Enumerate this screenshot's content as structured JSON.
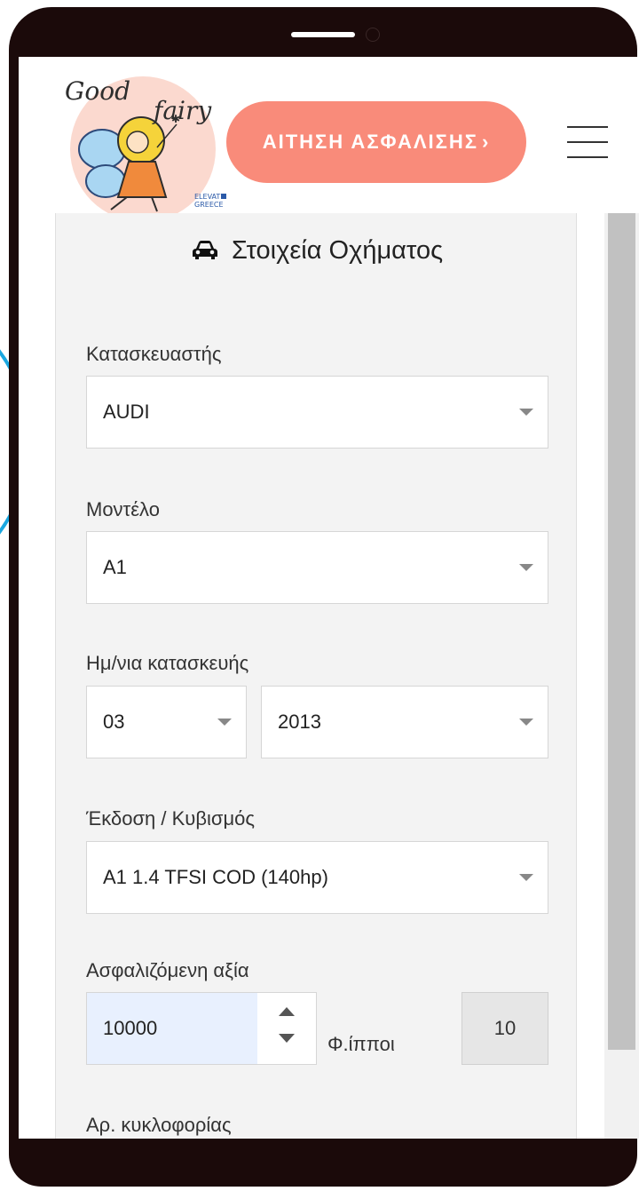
{
  "header": {
    "logo": {
      "line1": "Good",
      "line2": "fairy",
      "badge_line1": "ELEVATE",
      "badge_line2": "GREECE"
    },
    "cta_label": "ΑΙΤΗΣΗ ΑΣΦΑΛΙΣΗΣ",
    "cta_arrow": "›"
  },
  "section": {
    "title": "Στοιχεία Οχήματος",
    "icon": "car-icon"
  },
  "fields": {
    "manufacturer": {
      "label": "Κατασκευαστής",
      "value": "AUDI"
    },
    "model": {
      "label": "Μοντέλο",
      "value": "A1"
    },
    "build_date": {
      "label": "Ημ/νια κατασκευής",
      "month": "03",
      "year": "2013"
    },
    "version": {
      "label": "Έκδοση / Κυβισμός",
      "value": "A1 1.4 TFSI COD (140hp)"
    },
    "insured_value": {
      "label": "Ασφαλιζόμενη αξία",
      "value": "10000"
    },
    "fiscal_hp": {
      "label": "Φ.ίπποι",
      "value": "10"
    },
    "plate": {
      "label": "Αρ. κυκλοφορίας"
    }
  },
  "colors": {
    "cta": "#f98b7a",
    "accent_arc": "#1aa7e0",
    "phone_frame": "#1b0a0a",
    "panel_bg": "#f3f3f3",
    "autofill_bg": "#e8f0fe"
  }
}
